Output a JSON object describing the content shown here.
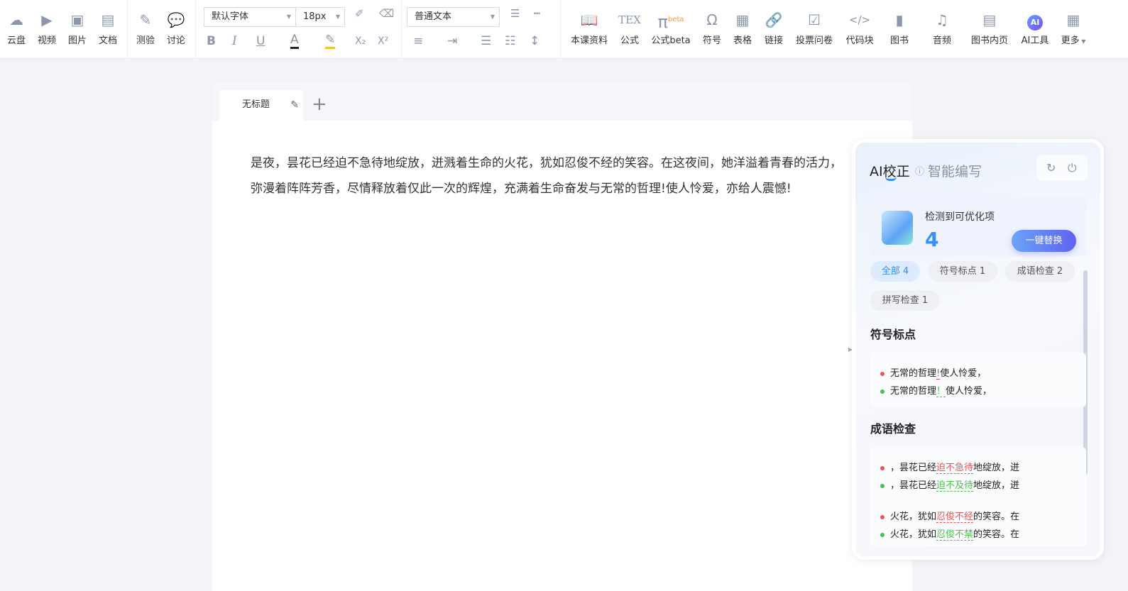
{
  "toolbar": {
    "left": [
      {
        "label": "云盘",
        "icon": "cloud-icon"
      },
      {
        "label": "视频",
        "icon": "video-icon"
      },
      {
        "label": "图片",
        "icon": "image-icon"
      },
      {
        "label": "文档",
        "icon": "document-icon"
      },
      {
        "label": "测验",
        "icon": "quiz-icon"
      },
      {
        "label": "讨论",
        "icon": "discussion-icon"
      }
    ],
    "font_family": "默认字体",
    "font_size": "18px",
    "paragraph_style": "普通文本",
    "format": {
      "bold": "B",
      "italic": "I",
      "underline": "U",
      "font_color": "A",
      "subscript": "X₂",
      "superscript": "X²"
    },
    "right": [
      {
        "label": "本课资料"
      },
      {
        "label": "公式"
      },
      {
        "label": "公式beta",
        "badge": "beta"
      },
      {
        "label": "符号"
      },
      {
        "label": "表格"
      },
      {
        "label": "链接"
      },
      {
        "label": "投票问卷"
      },
      {
        "label": "代码块"
      },
      {
        "label": "图书"
      },
      {
        "label": "音频"
      },
      {
        "label": "图书内页"
      },
      {
        "label": "AI工具"
      },
      {
        "label": "更多"
      }
    ]
  },
  "editor": {
    "tab_title": "无标题",
    "lines": [
      "是夜，昙花已经迫不急待地绽放，迸溅着生命的火花，犹如忍俊不经的笑容。在这夜间，她洋溢着青春的活力，",
      "弥漫着阵阵芳香，尽情释放着仅此一次的辉煌，充满着生命奋发与无常的哲理!使人怜爱，亦给人震憾!"
    ]
  },
  "ai_panel": {
    "tab_active": "AI校正",
    "tab_other": "智能编写",
    "detect_label": "检测到可优化项",
    "detect_count": "4",
    "replace_all": "一键替换",
    "filters": [
      "全部 4",
      "符号标点 1",
      "成语检查 2",
      "拼写检查 1"
    ],
    "sections": {
      "punct": {
        "title": "符号标点",
        "wrong": {
          "pre": "无常的哲理",
          "hl": "!",
          "post": "使人怜爱，"
        },
        "right": {
          "pre": "无常的哲理",
          "hl": "！",
          "post": "使人怜爱，"
        }
      },
      "idiom": {
        "title": "成语检查",
        "items": [
          {
            "wrong": {
              "pre": "，昙花已经",
              "hl": "迫不急待",
              "post": "地绽放，迸"
            },
            "right": {
              "pre": "，昙花已经",
              "hl": "迫不及待",
              "post": "地绽放，迸"
            }
          },
          {
            "wrong": {
              "pre": "火花，犹如",
              "hl": "忍俊不经",
              "post": "的笑容。在"
            },
            "right": {
              "pre": "火花，犹如",
              "hl": "忍俊不禁",
              "post": "的笑容。在"
            }
          }
        ]
      }
    },
    "colors": {
      "accent": "#3a8ff5",
      "error": "#e95454",
      "ok": "#4cbe4c"
    }
  }
}
